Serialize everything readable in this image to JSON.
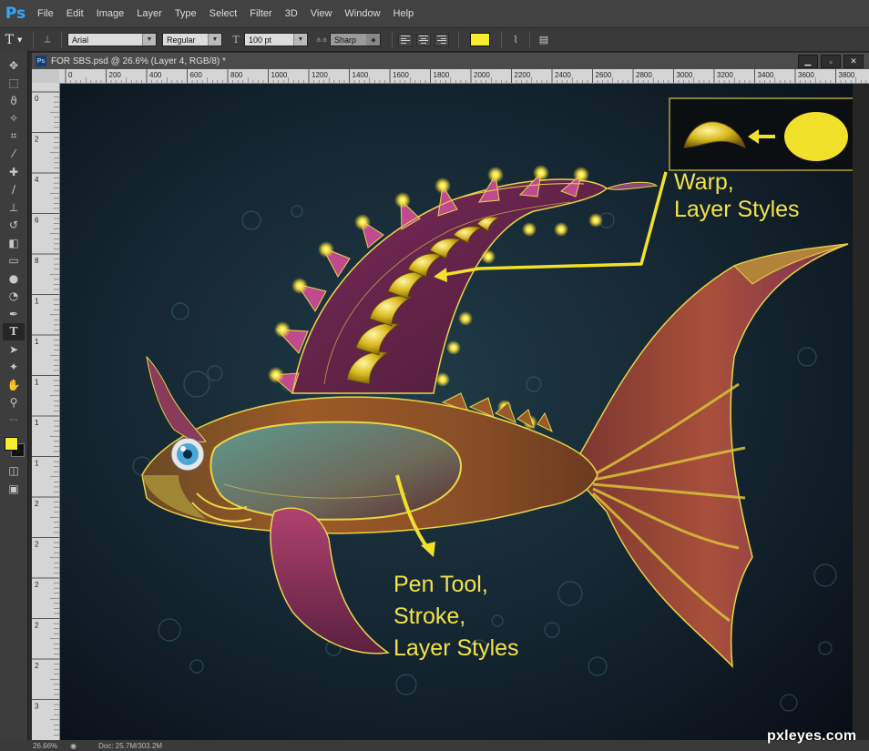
{
  "app": {
    "logo": "Ps"
  },
  "menu": [
    "File",
    "Edit",
    "Image",
    "Layer",
    "Type",
    "Select",
    "Filter",
    "3D",
    "View",
    "Window",
    "Help"
  ],
  "options": {
    "tool_icon": "T",
    "font_family": "Arial",
    "font_style": "Regular",
    "font_size": "100 pt",
    "aa_icon": "a a",
    "antialias": "Sharp",
    "text_color": "#f7ec2e"
  },
  "document": {
    "title": "FOR SBS.psd @ 26.6% (Layer 4, RGB/8) *",
    "controls": [
      "minimize-icon",
      "restore-icon",
      "close-icon"
    ],
    "ruler_h": [
      "0",
      "200",
      "400",
      "600",
      "800",
      "1000",
      "1200",
      "1400",
      "1600",
      "1800",
      "2000",
      "2200",
      "2400",
      "2600",
      "2800",
      "3000",
      "3200",
      "3400",
      "3600",
      "3800"
    ],
    "ruler_v": [
      "0",
      "2",
      "4",
      "6",
      "8",
      "1",
      "1",
      "1",
      "1",
      "1",
      "2",
      "2",
      "2",
      "2",
      "2",
      "3"
    ]
  },
  "tools": [
    "move-icon",
    "marquee-icon",
    "lasso-icon",
    "magic-wand-icon",
    "crop-icon",
    "eyedropper-icon",
    "healing-icon",
    "brush-icon",
    "stamp-icon",
    "history-brush-icon",
    "eraser-icon",
    "gradient-icon",
    "blur-icon",
    "dodge-icon",
    "pen-icon",
    "type-icon",
    "path-select-icon",
    "shape-icon",
    "hand-icon",
    "zoom-icon"
  ],
  "swatches": {
    "foreground": "#f7ec2e",
    "background": "#111111"
  },
  "annotations": {
    "warp": [
      "Warp,",
      "Layer Styles"
    ],
    "pen": [
      "Pen Tool,",
      "Stroke,",
      "Layer Styles"
    ]
  },
  "status": {
    "zoom": "26.66%",
    "doc": "Doc: 25.7M/303.2M"
  },
  "watermark": "pxleyes.com"
}
